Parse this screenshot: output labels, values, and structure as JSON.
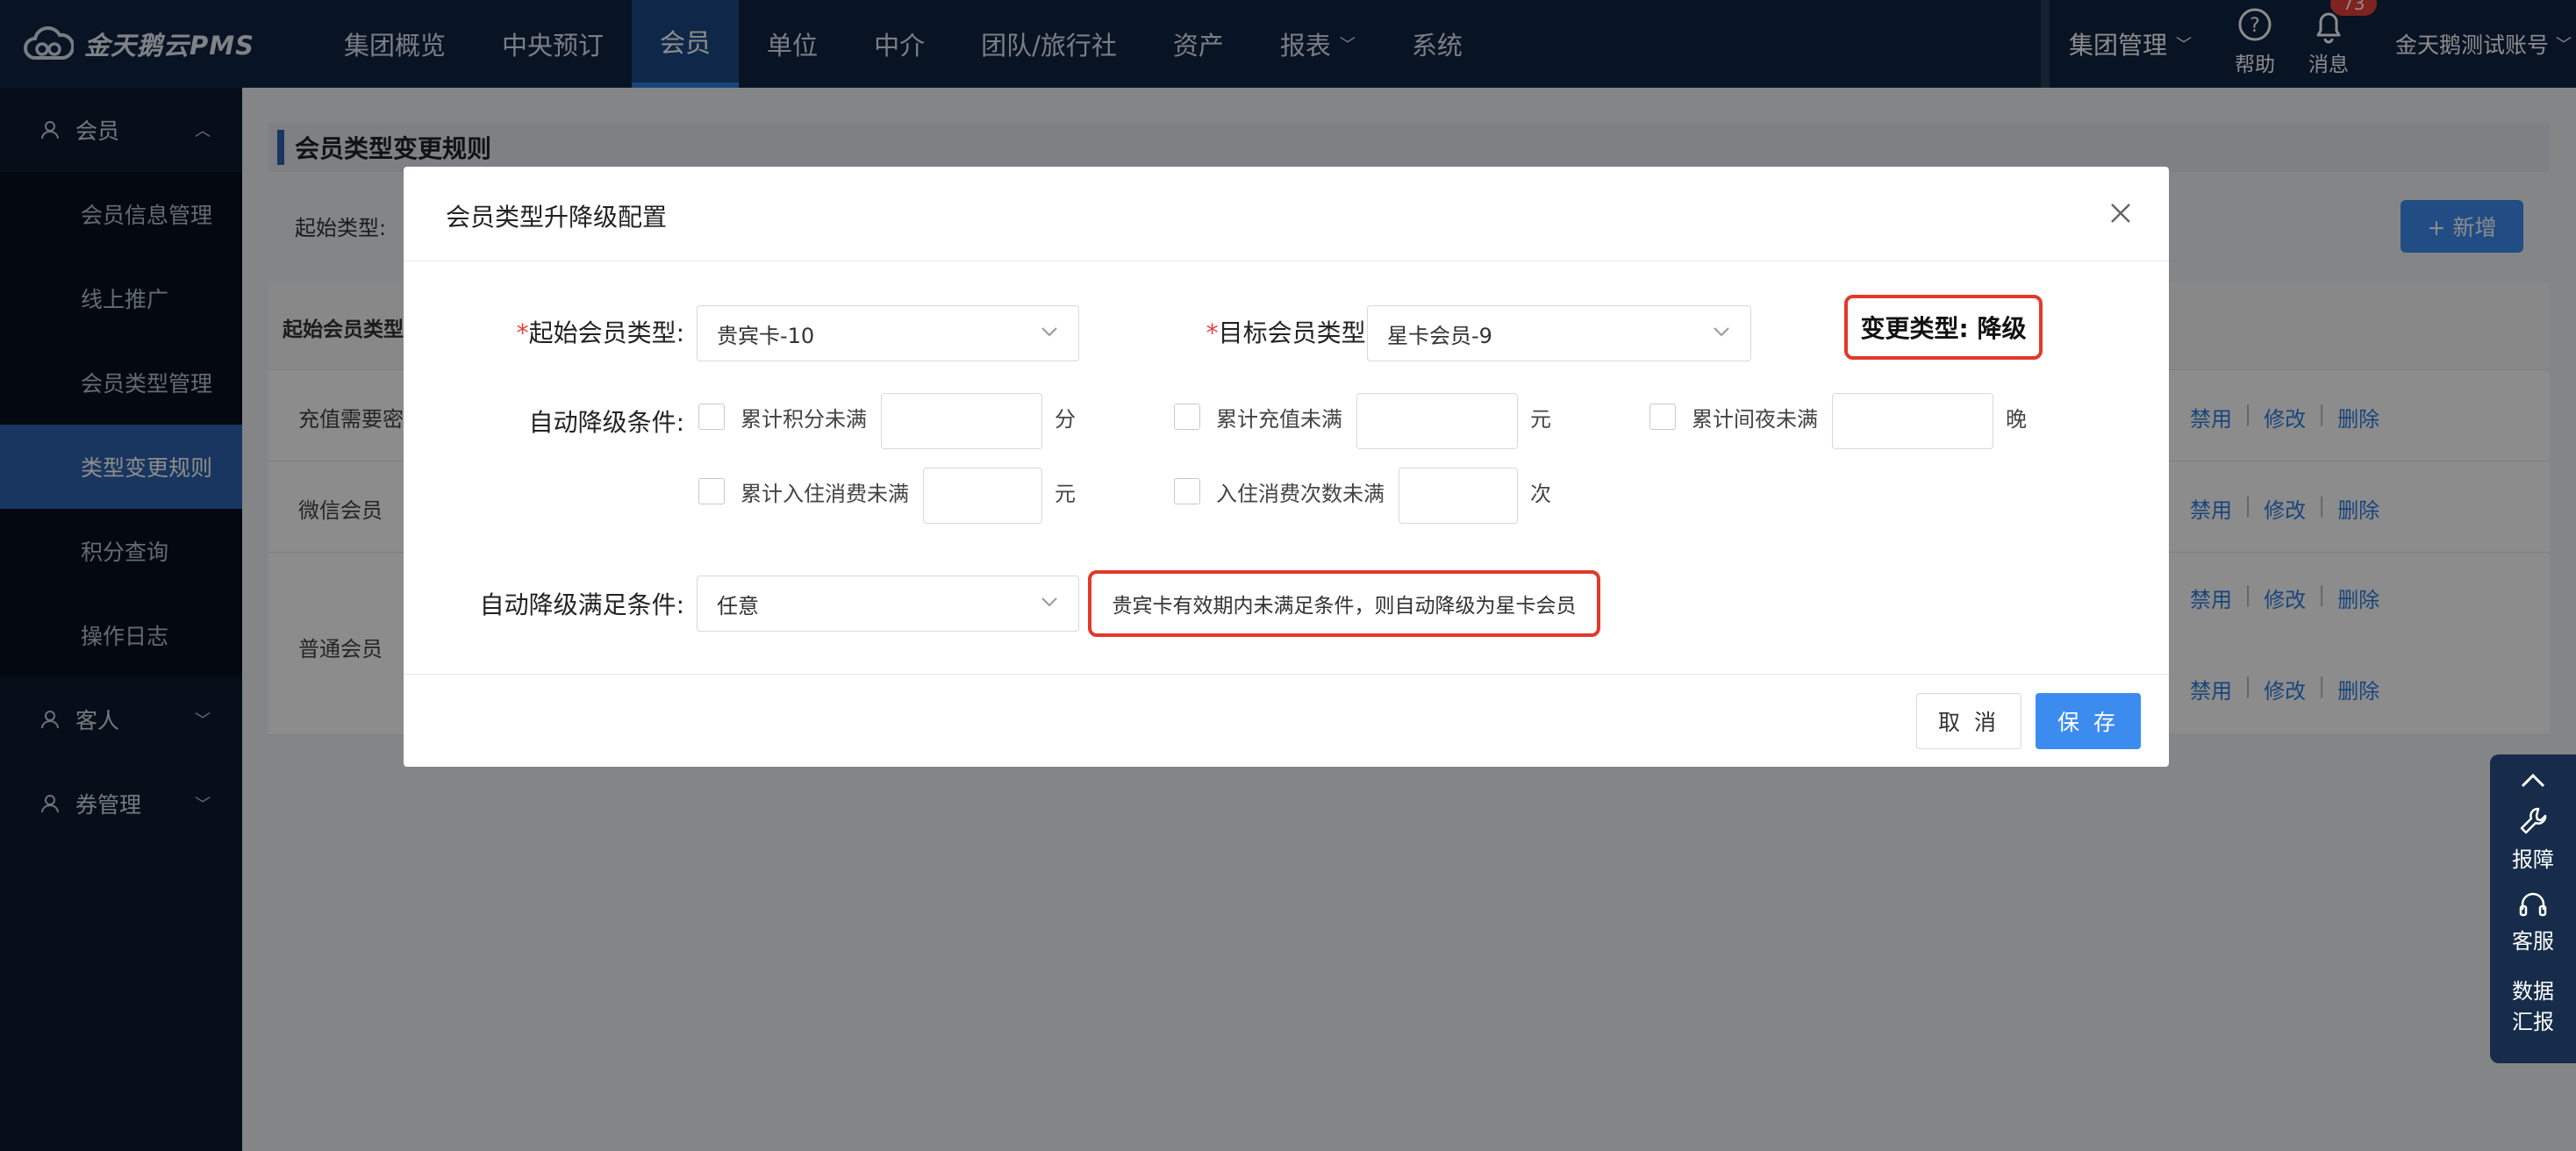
{
  "app": {
    "logo_text": "金天鹅云PMS",
    "logo_icon": "cloud-icon"
  },
  "topnav": {
    "items": [
      "集团概览",
      "中央预订",
      "会员",
      "单位",
      "中介",
      "团队/旅行社",
      "资产",
      "报表",
      "系统"
    ],
    "active": "会员",
    "group_mgmt": "集团管理",
    "help_label": "帮助",
    "msg_label": "消息",
    "msg_badge": "73",
    "account": "金天鹅测试账号"
  },
  "sidebar": {
    "groups": [
      {
        "label": "会员",
        "expanded": true,
        "items": [
          "会员信息管理",
          "线上推广",
          "会员类型管理",
          "类型变更规则",
          "积分查询",
          "操作日志"
        ]
      },
      {
        "label": "客人",
        "expanded": false
      },
      {
        "label": "券管理",
        "expanded": false
      }
    ],
    "active_item": "类型变更规则"
  },
  "page": {
    "title": "会员类型变更规则",
    "filter_label": "起始类型:",
    "add_button": "+ 新增",
    "table_header_first": "起始会员类型",
    "rows": [
      {
        "name": "充值需要密"
      },
      {
        "name": "微信会员"
      },
      {
        "name": "普通会员"
      },
      {
        "name": ""
      }
    ],
    "row_actions": [
      "禁用",
      "修改",
      "删除"
    ]
  },
  "float_panel": {
    "report": "报障",
    "service": "客服",
    "data1": "数据",
    "data2": "汇报"
  },
  "modal": {
    "title": "会员类型升降级配置",
    "start_type_label": "起始会员类型:",
    "start_type_value": "贵宾卡-10",
    "target_type_label": "目标会员类型:",
    "target_type_value": "星卡会员-9",
    "change_type": "变更类型: 降级",
    "downgrade_label": "自动降级条件:",
    "conditions": {
      "points": {
        "label": "累计积分未满",
        "unit": "分"
      },
      "recharge": {
        "label": "累计充值未满",
        "unit": "元"
      },
      "nights": {
        "label": "累计间夜未满",
        "unit": "晚"
      },
      "stay_spend": {
        "label": "累计入住消费未满",
        "unit": "元"
      },
      "stay_count": {
        "label": "入住消费次数未满",
        "unit": "次"
      }
    },
    "satisfy_label": "自动降级满足条件:",
    "satisfy_value": "任意",
    "hint": "贵宾卡有效期内未满足条件，则自动降级为星卡会员",
    "cancel": "取 消",
    "save": "保 存"
  },
  "colors": {
    "primary": "#3c8cf0",
    "topbar": "#0f2442",
    "sidebar": "#0b1a2f",
    "highlight": "#e2392b",
    "required": "#e8413b"
  }
}
